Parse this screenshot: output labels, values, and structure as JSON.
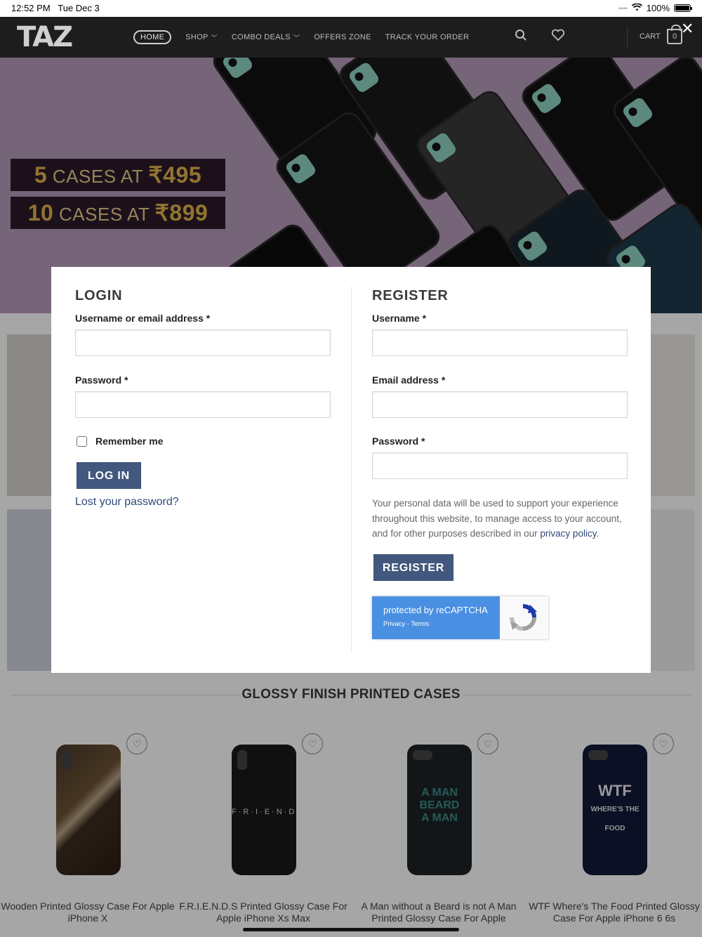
{
  "status_bar": {
    "time": "12:52 PM",
    "date": "Tue Dec 3",
    "battery": "100%"
  },
  "header": {
    "logo": "TAZ",
    "nav": [
      {
        "label": "HOME",
        "active": true,
        "dropdown": false
      },
      {
        "label": "SHOP",
        "active": false,
        "dropdown": true
      },
      {
        "label": "COMBO DEALS",
        "active": false,
        "dropdown": true
      },
      {
        "label": "OFFERS ZONE",
        "active": false,
        "dropdown": false
      },
      {
        "label": "TRACK YOUR ORDER",
        "active": false,
        "dropdown": false
      }
    ],
    "cart_label": "CART",
    "cart_count": "0",
    "icons": [
      "search-icon",
      "heart-icon",
      "cart-icon",
      "close-icon"
    ]
  },
  "banner": {
    "offer1_count": "5",
    "offer1_text": "CASES AT",
    "offer1_price": "₹495",
    "offer2_count": "10",
    "offer2_text": "CASES AT",
    "offer2_price": "₹899"
  },
  "modal": {
    "login": {
      "heading": "LOGIN",
      "username_label": "Username or email address *",
      "username_value": "",
      "password_label": "Password *",
      "password_value": "",
      "remember_label": "Remember me",
      "remember_checked": false,
      "submit_label": "LOG IN",
      "lost_password": "Lost your password?"
    },
    "register": {
      "heading": "REGISTER",
      "username_label": "Username *",
      "email_label": "Email address *",
      "password_label": "Password *",
      "privacy_text": "Your personal data will be used to support your experience throughout this website, to manage access to your account, and for other purposes described in our",
      "privacy_link": "privacy policy",
      "privacy_end": ".",
      "submit_label": "REGISTER",
      "recaptcha_text": "protected by reCAPTCHA",
      "recaptcha_links": "Privacy - Terms"
    }
  },
  "section_title": "GLOSSY FINISH PRINTED CASES",
  "products": [
    {
      "name": "Wooden Printed Glossy Case For Apple iPhone X"
    },
    {
      "name": "F.R.I.E.N.D.S Printed Glossy Case For Apple iPhone Xs Max"
    },
    {
      "name": "A Man without a Beard is not A Man Printed Glossy Case For Apple"
    },
    {
      "name": "WTF Where's The Food Printed Glossy Case For Apple iPhone 6 6s"
    }
  ],
  "colors": {
    "header_bg": "#1d1d1d",
    "button": "#43587e",
    "hero_bg": "#b59ab8",
    "recaptcha_blue": "#4a90e2"
  }
}
